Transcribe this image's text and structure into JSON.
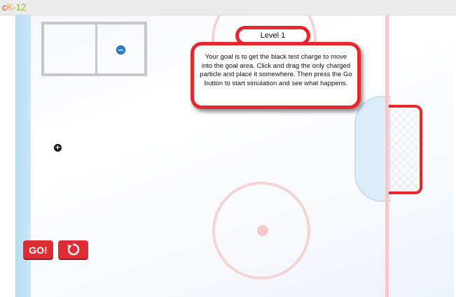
{
  "header": {
    "logo_text_c": "c",
    "logo_text_k": "K",
    "logo_text_dash": "-",
    "logo_text_num": "12"
  },
  "game": {
    "level_label": "Level 1",
    "instructions": "Your goal is to get the black test charge to move into the goal area. Click and drag the only charged particle and place it somewhere. Then press the Go button to start simulation and see what happens.",
    "negative_particle_symbol": "−",
    "test_charge_symbol": "+",
    "go_button_label": "GO!",
    "reset_button_icon": "reset-icon"
  },
  "colors": {
    "accent_red": "#e8262c",
    "blue_line": "#b9dcf2",
    "particle_blue": "#2f80c8",
    "test_charge": "#111111",
    "minimap_border": "#c7c7c7"
  }
}
